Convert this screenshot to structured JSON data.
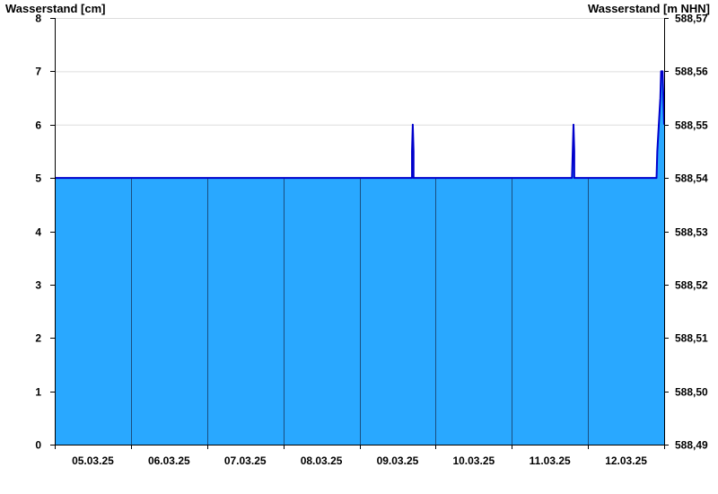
{
  "chart_data": {
    "type": "area",
    "ylabel_left": "Wasserstand [cm]",
    "ylabel_right": "Wasserstand [m NHN]",
    "ylim_left": [
      0,
      8
    ],
    "yticks_left": [
      "0",
      "1",
      "2",
      "3",
      "4",
      "5",
      "6",
      "7",
      "8"
    ],
    "ylim_right": [
      588.49,
      588.57
    ],
    "yticks_right": [
      "588,49",
      "588,50",
      "588,51",
      "588,52",
      "588,53",
      "588,54",
      "588,55",
      "588,56",
      "588,57"
    ],
    "x_categories": [
      "05.03.25",
      "06.03.25",
      "07.03.25",
      "08.03.25",
      "09.03.25",
      "10.03.25",
      "11.03.25",
      "12.03.25"
    ],
    "x_range_days": [
      0,
      8
    ],
    "grid": true,
    "colors": {
      "fill": "#29a8ff",
      "line": "#0000cc",
      "grid": "#dddddd",
      "day_separator": "#1a4f80"
    },
    "series": [
      {
        "points": [
          [
            0,
            5
          ],
          [
            4.69,
            5
          ],
          [
            4.69,
            5.5
          ],
          [
            4.7,
            6
          ],
          [
            4.71,
            5.5
          ],
          [
            4.71,
            5
          ],
          [
            6.79,
            5
          ],
          [
            6.8,
            5.5
          ],
          [
            6.81,
            6
          ],
          [
            6.82,
            5.5
          ],
          [
            6.82,
            5
          ],
          [
            7.9,
            5
          ],
          [
            7.91,
            5.5
          ],
          [
            7.93,
            6
          ],
          [
            7.95,
            6.5
          ],
          [
            7.96,
            7
          ],
          [
            7.98,
            7
          ],
          [
            7.99,
            6.5
          ],
          [
            8,
            6
          ]
        ]
      }
    ]
  }
}
